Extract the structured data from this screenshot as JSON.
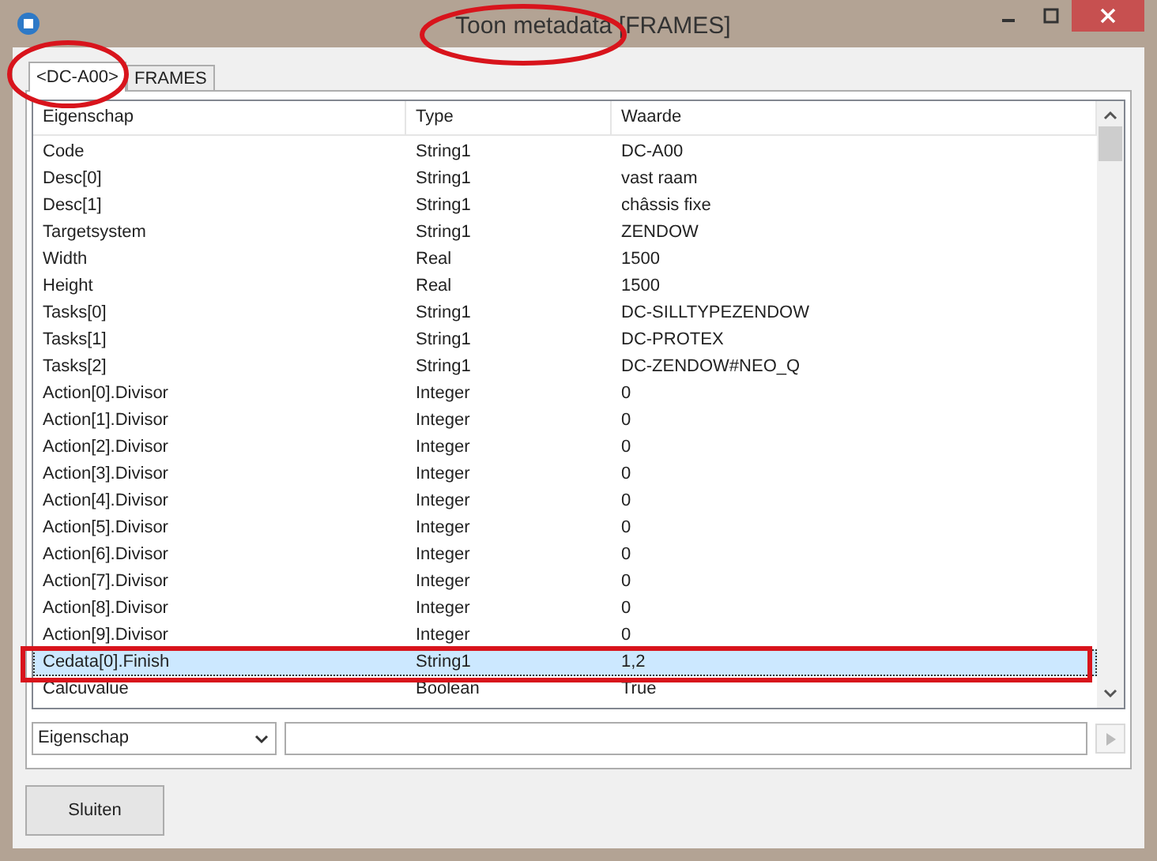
{
  "window": {
    "title": "Toon metadata [FRAMES]"
  },
  "tabs": [
    {
      "label": "<DC-A00>",
      "selected": true
    },
    {
      "label": "FRAMES",
      "selected": false
    }
  ],
  "table": {
    "columns": [
      "Eigenschap",
      "Type",
      "Waarde"
    ],
    "rows": [
      {
        "cells": [
          "Code",
          "String1",
          "DC-A00"
        ],
        "selected": false
      },
      {
        "cells": [
          "Desc[0]",
          "String1",
          "vast raam"
        ],
        "selected": false
      },
      {
        "cells": [
          "Desc[1]",
          "String1",
          "châssis fixe"
        ],
        "selected": false
      },
      {
        "cells": [
          "Targetsystem",
          "String1",
          "ZENDOW"
        ],
        "selected": false
      },
      {
        "cells": [
          "Width",
          "Real",
          "1500"
        ],
        "selected": false
      },
      {
        "cells": [
          "Height",
          "Real",
          "1500"
        ],
        "selected": false
      },
      {
        "cells": [
          "Tasks[0]",
          "String1",
          "DC-SILLTYPEZENDOW"
        ],
        "selected": false
      },
      {
        "cells": [
          "Tasks[1]",
          "String1",
          "DC-PROTEX"
        ],
        "selected": false
      },
      {
        "cells": [
          "Tasks[2]",
          "String1",
          "DC-ZENDOW#NEO_Q"
        ],
        "selected": false
      },
      {
        "cells": [
          "Action[0].Divisor",
          "Integer",
          "0"
        ],
        "selected": false
      },
      {
        "cells": [
          "Action[1].Divisor",
          "Integer",
          "0"
        ],
        "selected": false
      },
      {
        "cells": [
          "Action[2].Divisor",
          "Integer",
          "0"
        ],
        "selected": false
      },
      {
        "cells": [
          "Action[3].Divisor",
          "Integer",
          "0"
        ],
        "selected": false
      },
      {
        "cells": [
          "Action[4].Divisor",
          "Integer",
          "0"
        ],
        "selected": false
      },
      {
        "cells": [
          "Action[5].Divisor",
          "Integer",
          "0"
        ],
        "selected": false
      },
      {
        "cells": [
          "Action[6].Divisor",
          "Integer",
          "0"
        ],
        "selected": false
      },
      {
        "cells": [
          "Action[7].Divisor",
          "Integer",
          "0"
        ],
        "selected": false
      },
      {
        "cells": [
          "Action[8].Divisor",
          "Integer",
          "0"
        ],
        "selected": false
      },
      {
        "cells": [
          "Action[9].Divisor",
          "Integer",
          "0"
        ],
        "selected": false
      },
      {
        "cells": [
          "Cedata[0].Finish",
          "String1",
          "1,2"
        ],
        "selected": true
      },
      {
        "cells": [
          "Calcuvalue",
          "Boolean",
          "True"
        ],
        "selected": false
      }
    ]
  },
  "filter": {
    "field": "Eigenschap"
  },
  "buttons": [
    "Sluiten"
  ]
}
